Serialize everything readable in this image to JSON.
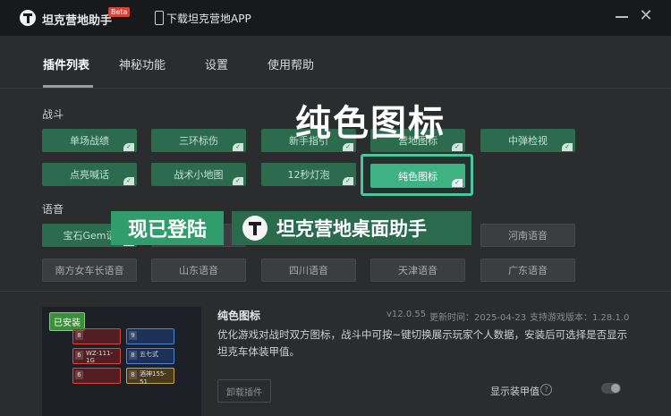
{
  "titlebar": {
    "app_title": "坦克营地助手",
    "beta": "Beta",
    "download_link": "下载坦克营地APP",
    "close_glyph": "✕"
  },
  "tabs": [
    {
      "label": "插件列表",
      "active": true
    },
    {
      "label": "神秘功能"
    },
    {
      "label": "设置"
    },
    {
      "label": "使用帮助"
    }
  ],
  "sections": {
    "battle": "战斗",
    "voice": "语音"
  },
  "battle_plugins": [
    "单场战绩",
    "三环标伤",
    "新手指引",
    "营地图标",
    "中弹检视",
    "点亮喊话",
    "战术小地图",
    "12秒灯泡"
  ],
  "highlighted_plugin": "纯色图标",
  "voice_plugins_row1": [
    "宝石Gem语",
    "音",
    "河南语音"
  ],
  "voice_plugins_row2": [
    "南方女车长语音",
    "山东语音",
    "四川语音",
    "天津语音",
    "广东语音"
  ],
  "overlay": {
    "big_title": "纯色图标",
    "login_badge": "现已登陆",
    "brand_text": "坦克营地桌面助手"
  },
  "preview": {
    "installed": "已安装",
    "cards": [
      {
        "num": "8",
        "text": ""
      },
      {
        "num": "9",
        "text": ""
      },
      {
        "num": "6",
        "text": "WZ-111-1G"
      },
      {
        "num": "8",
        "text": "五七式"
      },
      {
        "num": "6",
        "text": ""
      },
      {
        "num": "8",
        "text": "酒神155-51"
      }
    ]
  },
  "detail": {
    "name": "纯色图标",
    "version": "v12.0.55",
    "updated": "更新时间：2025-04-23",
    "supported": "支持游戏版本：1.28.1.0",
    "description": "优化游戏对战时双方图标，战斗中可按~键切换展示玩家个人数据，安装后可选择是否显示坦克车体装甲值。",
    "uninstall": "卸载插件",
    "toggle_label": "显示装甲值",
    "help_glyph": "?"
  },
  "colors": {
    "accent_green": "#3fb283",
    "frame_green": "#47c79b",
    "muted_green": "#2d6b4f"
  }
}
